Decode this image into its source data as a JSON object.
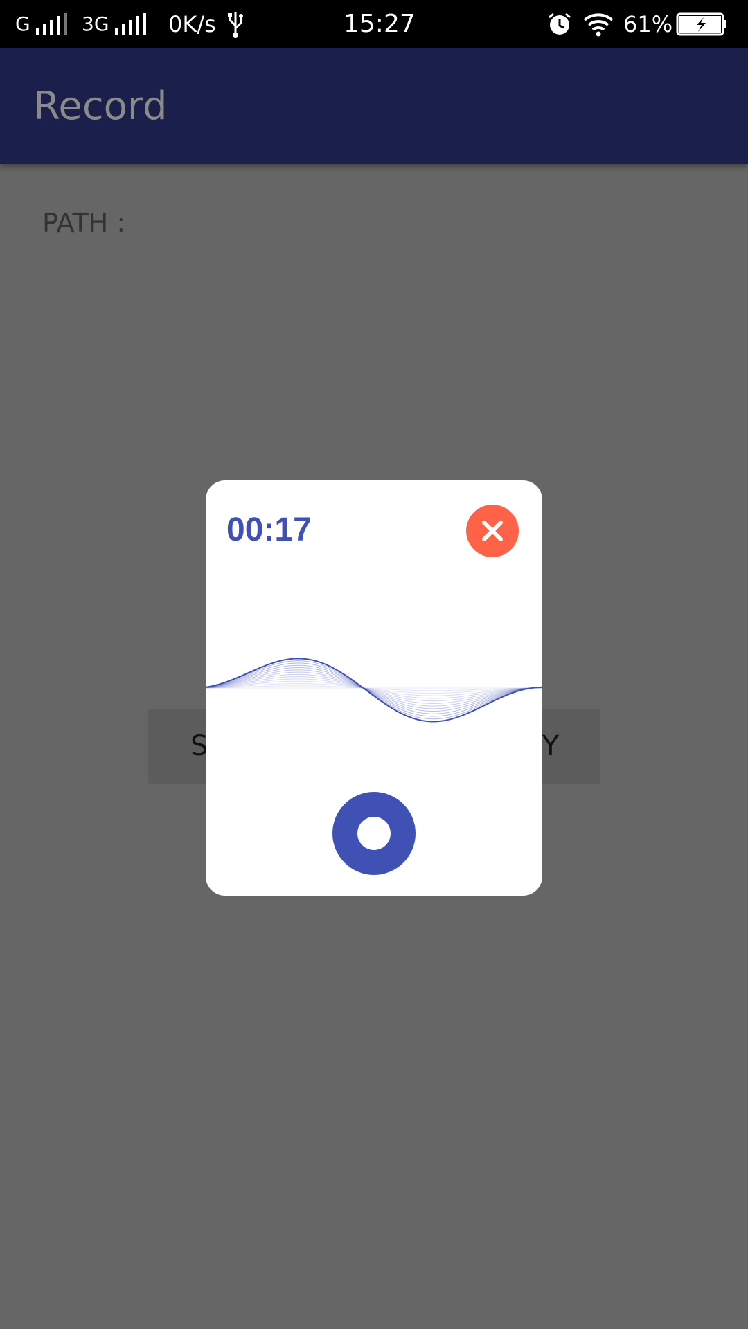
{
  "status_bar": {
    "network_1": "G",
    "network_2": "3G",
    "speed": "0K/s",
    "time": "15:27",
    "battery": "61%"
  },
  "appbar": {
    "title": "Record"
  },
  "main": {
    "path_label": "PATH :",
    "button_left_label": "S",
    "button_right_label": "Y"
  },
  "dialog": {
    "timer": "00:17",
    "close_icon": "close-icon",
    "record_icon": "record-icon",
    "accent_color": "#3f51b5",
    "close_color": "#ff6347"
  }
}
